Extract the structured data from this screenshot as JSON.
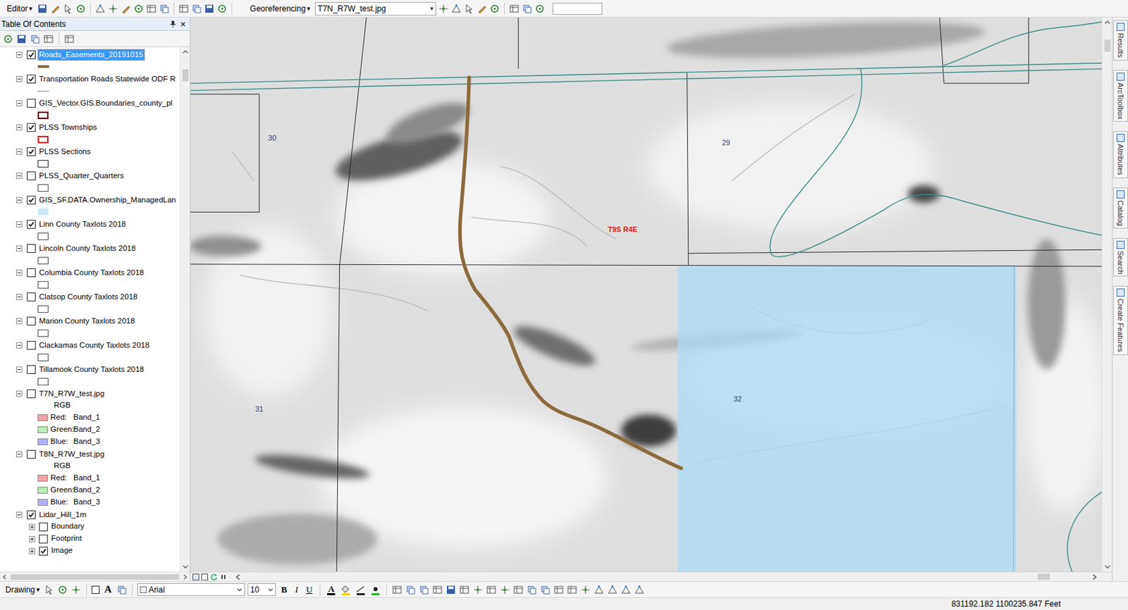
{
  "toolbar": {
    "editor": {
      "label": "Editor",
      "arrow": "▾"
    },
    "georeferencing": {
      "label": "Georeferencing",
      "arrow": "▾"
    },
    "layer_dropdown": {
      "value": "T7N_R7W_test.jpg",
      "arrow": "▾"
    },
    "scale_field": {
      "value": ""
    }
  },
  "toc": {
    "title": "Table Of Contents",
    "close": "×",
    "layers": [
      {
        "name": "Roads_Easements_20191015",
        "checked": true,
        "expanded": true,
        "selected": true,
        "kind": "vector",
        "symbol": {
          "kind": "line",
          "color": "#8b6a3e",
          "thick": true
        }
      },
      {
        "name": "Transportation Roads Statewide ODF R",
        "checked": true,
        "expanded": true,
        "selected": false,
        "kind": "vector",
        "symbol": {
          "kind": "line",
          "color": "#6b8fc4",
          "thick": false
        }
      },
      {
        "name": "GIS_Vector.GIS.Boundaries_county_pl",
        "checked": false,
        "expanded": true,
        "selected": false,
        "kind": "vector",
        "symbol": {
          "kind": "outline",
          "color": "#6b0000",
          "thick": true
        }
      },
      {
        "name": "PLSS Townships",
        "checked": true,
        "expanded": true,
        "selected": false,
        "kind": "vector",
        "symbol": {
          "kind": "outline",
          "color": "#e02020",
          "thick": true
        }
      },
      {
        "name": "PLSS Sections",
        "checked": true,
        "expanded": true,
        "selected": false,
        "kind": "vector",
        "symbol": {
          "kind": "outline",
          "color": "#333333",
          "thick": false
        }
      },
      {
        "name": "PLSS_Quarter_Quarters",
        "checked": false,
        "expanded": true,
        "selected": false,
        "kind": "vector",
        "symbol": {
          "kind": "outline",
          "color": "#555555",
          "thick": false
        }
      },
      {
        "name": "GIS_SF.DATA.Ownership_ManagedLan",
        "checked": true,
        "expanded": true,
        "selected": false,
        "kind": "vector",
        "symbol": {
          "kind": "fill",
          "color": "#cde9f8",
          "thick": false
        }
      },
      {
        "name": "Linn County Taxlots 2018",
        "checked": true,
        "expanded": true,
        "selected": false,
        "kind": "vector",
        "symbol": {
          "kind": "outline",
          "color": "#555555",
          "thick": false
        }
      },
      {
        "name": "Lincoln County Taxlots 2018",
        "checked": false,
        "expanded": true,
        "selected": false,
        "kind": "vector",
        "symbol": {
          "kind": "outline",
          "color": "#555555",
          "thick": false
        }
      },
      {
        "name": "Columbia County Taxlots 2018",
        "checked": false,
        "expanded": true,
        "selected": false,
        "kind": "vector",
        "symbol": {
          "kind": "outline",
          "color": "#555555",
          "thick": false
        }
      },
      {
        "name": "Clatsop County Taxlots 2018",
        "checked": false,
        "expanded": true,
        "selected": false,
        "kind": "vector",
        "symbol": {
          "kind": "outline",
          "color": "#555555",
          "thick": false
        }
      },
      {
        "name": "Marion County Taxlots 2018",
        "checked": false,
        "expanded": true,
        "selected": false,
        "kind": "vector",
        "symbol": {
          "kind": "outline",
          "color": "#555555",
          "thick": false
        }
      },
      {
        "name": "Clackamas County Taxlots 2018",
        "checked": false,
        "expanded": true,
        "selected": false,
        "kind": "vector",
        "symbol": {
          "kind": "outline",
          "color": "#555555",
          "thick": false
        }
      },
      {
        "name": "Tillamook County Taxlots 2018",
        "checked": false,
        "expanded": true,
        "selected": false,
        "kind": "vector",
        "symbol": {
          "kind": "outline",
          "color": "#555555",
          "thick": false
        }
      },
      {
        "name": "T7N_R7W_test.jpg",
        "checked": false,
        "expanded": true,
        "selected": false,
        "kind": "raster",
        "legend_title": "RGB",
        "bands": [
          {
            "channel": "Red:",
            "band": "Band_1",
            "color": "#f4a3a3"
          },
          {
            "channel": "Green:",
            "band": "Band_2",
            "color": "#b5f0b0"
          },
          {
            "channel": "Blue:",
            "band": "Band_3",
            "color": "#b3b3f2"
          }
        ]
      },
      {
        "name": "T8N_R7W_test.jpg",
        "checked": false,
        "expanded": true,
        "selected": false,
        "kind": "raster",
        "legend_title": "RGB",
        "bands": [
          {
            "channel": "Red:",
            "band": "Band_1",
            "color": "#f4a3a3"
          },
          {
            "channel": "Green:",
            "band": "Band_2",
            "color": "#b5f0b0"
          },
          {
            "channel": "Blue:",
            "band": "Band_3",
            "color": "#b3b3f2"
          }
        ]
      },
      {
        "name": "Lidar_Hill_1m",
        "checked": true,
        "expanded": true,
        "selected": false,
        "kind": "group",
        "children": [
          {
            "name": "Boundary",
            "checked": false,
            "expanded": false
          },
          {
            "name": "Footprint",
            "checked": false,
            "expanded": false
          },
          {
            "name": "Image",
            "checked": true,
            "expanded": false
          }
        ]
      }
    ]
  },
  "map": {
    "labels": [
      {
        "text": "30",
        "color": "#2a3f7a"
      },
      {
        "text": "29",
        "color": "#2a3f7a"
      },
      {
        "text": "T9S R4E",
        "color": "#e02020"
      },
      {
        "text": "31",
        "color": "#2a3f7a"
      },
      {
        "text": "32",
        "color": "#2a3f7a"
      }
    ]
  },
  "dock_tabs": [
    "Results",
    "ArcToolbox",
    "Attributes",
    "Catalog",
    "Search",
    "Create Features"
  ],
  "drawing_toolbar": {
    "drawing": {
      "label": "Drawing",
      "arrow": "▾"
    },
    "text_tool": "A",
    "font": {
      "value": "Arial"
    },
    "size": {
      "value": "10"
    },
    "bold": "B",
    "italic": "I",
    "underline": "U",
    "font_color": "A"
  },
  "status_bar": {
    "coordinates": "831192.182 1100235.847 Feet"
  }
}
